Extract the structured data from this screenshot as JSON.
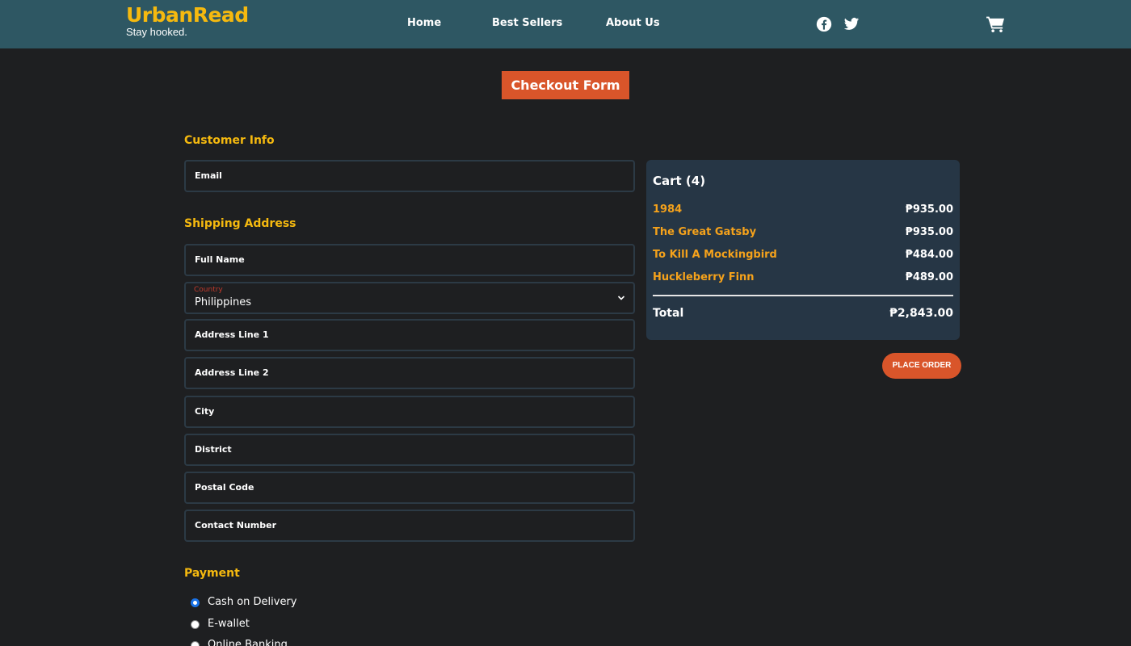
{
  "brand": {
    "name": "UrbanRead",
    "tagline": "Stay hooked."
  },
  "nav": {
    "links": [
      "Home",
      "Best Sellers",
      "About Us"
    ]
  },
  "social": {
    "icons": [
      "facebook-icon",
      "twitter-icon"
    ]
  },
  "header_cart_icon": "shopping-cart-icon",
  "form_title": "Checkout Form",
  "customer_info": {
    "heading": "Customer Info",
    "email_label": "Email"
  },
  "shipping": {
    "heading": "Shipping Address",
    "full_name_label": "Full Name",
    "country_caption": "Country",
    "country_value": "Philippines",
    "address1_label": "Address Line 1",
    "address2_label": "Address Line 2",
    "city_label": "City",
    "district_label": "District",
    "postal_label": "Postal Code",
    "contact_label": "Contact Number"
  },
  "payment": {
    "heading": "Payment",
    "options": [
      {
        "label": "Cash on Delivery",
        "checked": true
      },
      {
        "label": "E-wallet",
        "checked": false
      },
      {
        "label": "Online Banking",
        "checked": false
      }
    ]
  },
  "cart": {
    "title": "Cart (4)",
    "items": [
      {
        "name": "1984",
        "price": "₱935.00"
      },
      {
        "name": "The Great Gatsby",
        "price": "₱935.00"
      },
      {
        "name": "To Kill A Mockingbird",
        "price": "₱484.00"
      },
      {
        "name": "Huckleberry Finn",
        "price": "₱489.00"
      }
    ],
    "total_label": "Total",
    "total_value": "₱2,843.00"
  },
  "place_order_label": "PLACE ORDER",
  "colors": {
    "navbar": "#2e5763",
    "accent": "#f5b90f",
    "orange": "#d9552a",
    "cart_bg": "#263645",
    "background": "#1e1f21"
  }
}
